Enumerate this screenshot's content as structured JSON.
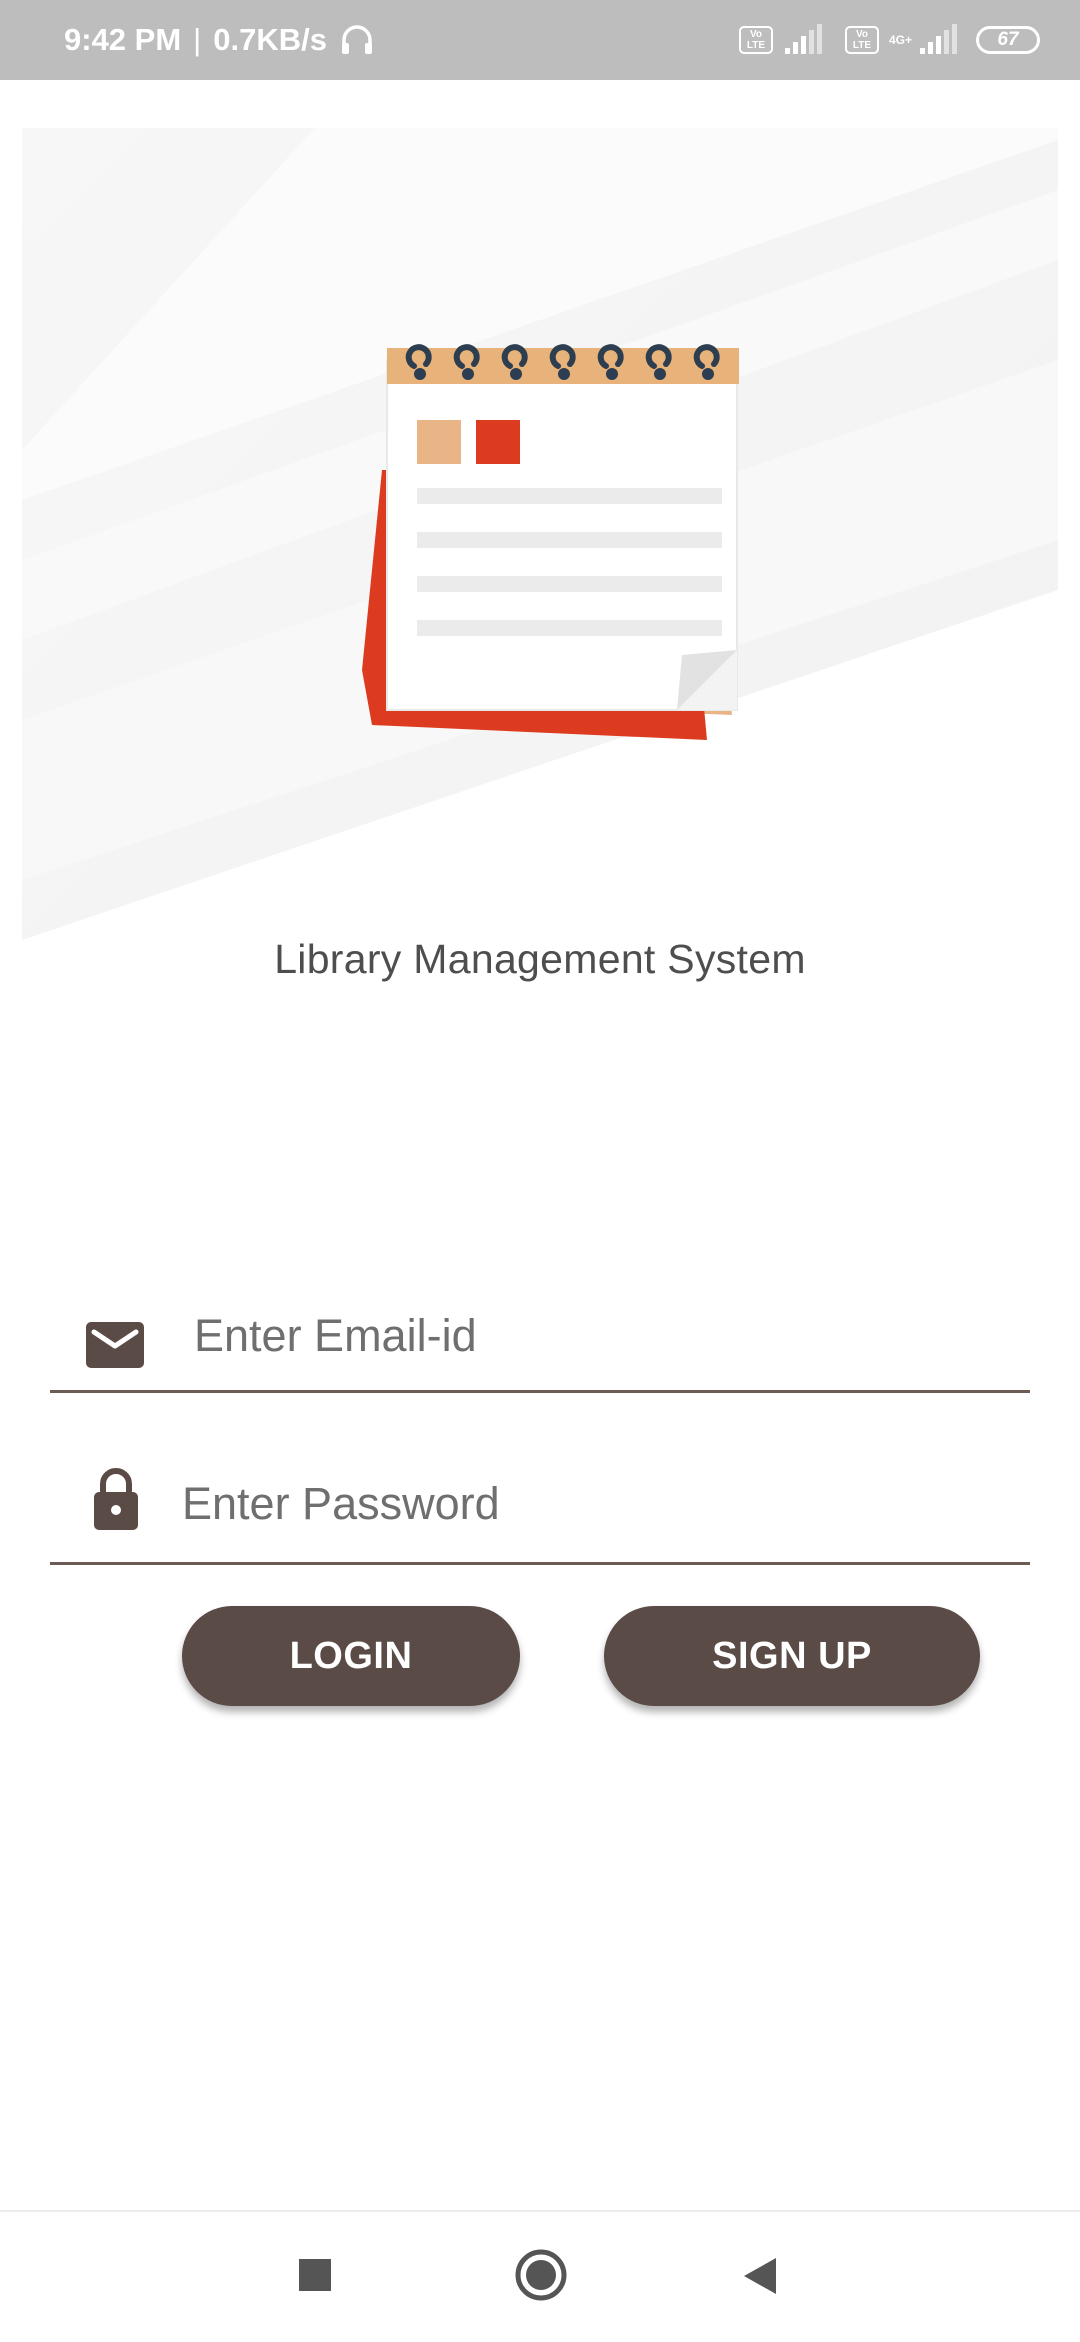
{
  "status_bar": {
    "time": "9:42 PM",
    "separator": "|",
    "net_speed": "0.7KB/s",
    "volte_label_1": "Vo LTE",
    "volte_label_2": "Vo LTE",
    "sim2_network": "4G+",
    "battery_level": "67",
    "icons": [
      "headset-icon",
      "volte-icon",
      "signal-icon",
      "volte-icon",
      "signal-icon",
      "battery-icon"
    ]
  },
  "hero": {
    "title": "Library Management System",
    "icon": "notepad-illustration",
    "colors": {
      "binding": "#e8b27b",
      "accent_red": "#dd3b1f",
      "accent_tan": "#e9b586",
      "rings": "#2c3e50"
    }
  },
  "form": {
    "email": {
      "placeholder": "Enter Email-id",
      "value": "",
      "icon": "mail-icon"
    },
    "password": {
      "placeholder": "Enter Password",
      "value": "",
      "icon": "lock-icon"
    },
    "login_label": "LOGIN",
    "signup_label": "SIGN UP"
  },
  "theme": {
    "primary": "#5b4b47",
    "underline": "#6d5b55",
    "status_bar_bg": "#bdbdbd"
  },
  "nav_bar": {
    "icons": [
      "recents-icon",
      "home-icon",
      "back-icon"
    ]
  }
}
